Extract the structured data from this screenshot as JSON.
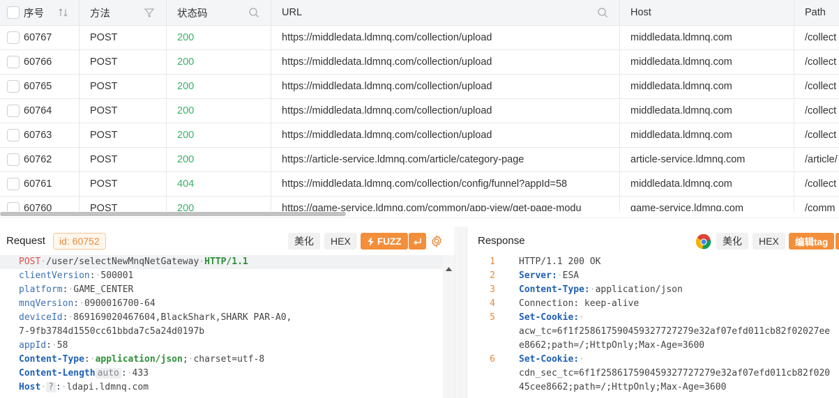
{
  "table": {
    "headers": {
      "seq": "序号",
      "method": "方法",
      "status": "状态码",
      "url": "URL",
      "host": "Host",
      "path": "Path"
    },
    "rows": [
      {
        "seq": "60767",
        "method": "POST",
        "status": "200",
        "url": "https://middledata.ldmnq.com/collection/upload",
        "host": "middledata.ldmnq.com",
        "path": "/collect"
      },
      {
        "seq": "60766",
        "method": "POST",
        "status": "200",
        "url": "https://middledata.ldmnq.com/collection/upload",
        "host": "middledata.ldmnq.com",
        "path": "/collect"
      },
      {
        "seq": "60765",
        "method": "POST",
        "status": "200",
        "url": "https://middledata.ldmnq.com/collection/upload",
        "host": "middledata.ldmnq.com",
        "path": "/collect"
      },
      {
        "seq": "60764",
        "method": "POST",
        "status": "200",
        "url": "https://middledata.ldmnq.com/collection/upload",
        "host": "middledata.ldmnq.com",
        "path": "/collect"
      },
      {
        "seq": "60763",
        "method": "POST",
        "status": "200",
        "url": "https://middledata.ldmnq.com/collection/upload",
        "host": "middledata.ldmnq.com",
        "path": "/collect"
      },
      {
        "seq": "60762",
        "method": "POST",
        "status": "200",
        "url": "https://article-service.ldmnq.com/article/category-page",
        "host": "article-service.ldmnq.com",
        "path": "/article/"
      },
      {
        "seq": "60761",
        "method": "POST",
        "status": "404",
        "url": "https://middledata.ldmnq.com/collection/config/funnel?appId=58",
        "host": "middledata.ldmnq.com",
        "path": "/collect"
      },
      {
        "seq": "60760",
        "method": "POST",
        "status": "200",
        "url": "https://game-service.ldmnq.com/common/app-view/get-page-modu",
        "host": "game-service.ldmnq.com",
        "path": "/comm"
      }
    ]
  },
  "request": {
    "title": "Request",
    "id_badge": "id: 60752",
    "beautify": "美化",
    "hex": "HEX",
    "fuzz": "FUZZ",
    "lines": {
      "method": "POST",
      "path": "/user/selectNewMnqNetGateway",
      "proto": "HTTP/1.1",
      "k1": "clientVersion",
      "v1": "500001",
      "k2": "platform",
      "v2": "GAME_CENTER",
      "k3": "mnqVersion",
      "v3": "0900016700-64",
      "k4": "deviceId",
      "v4a": "869169020467604,BlackShark,SHARK PAR-A0,",
      "v4b": "7-9fb3784d1550cc61bbda7c5a24d0197b",
      "k5": "appId",
      "v5": "58",
      "k6": "Content-Type",
      "v6a": "application/json",
      "v6b": "charset=utf-8",
      "k7": "Content-Length",
      "v7chip": "auto",
      "v7": "433",
      "k8": "Host",
      "v8chip": "?",
      "v8": "ldapi.ldmnq.com"
    }
  },
  "response": {
    "title": "Response",
    "beautify": "美化",
    "hex": "HEX",
    "edit_tag": "编辑tag",
    "lines": {
      "n1": "1",
      "l1": "HTTP/1.1 200 OK",
      "n2": "2",
      "k2": "Server:",
      "v2": "ESA",
      "n3": "3",
      "k3": "Content-Type:",
      "v3": "application/json",
      "n4": "4",
      "l4": "Connection: keep-alive",
      "n5": "5",
      "k5": "Set-Cookie:",
      "v5a": "acw_tc=6f1f258617590459327727279e32af07efd011cb82f02027ee",
      "v5b": "e8662;path=/;HttpOnly;Max-Age=3600",
      "n6": "6",
      "k6": "Set-Cookie:",
      "v6a": "cdn_sec_tc=6f1f258617590459327727279e32af07efd011cb82f020",
      "v6b": "45cee8662;path=/;HttpOnly;Max-Age=3600"
    }
  },
  "colors": {
    "accent": "#f38f3a",
    "status_ok": "#3bb06a",
    "key_blue": "#1f60b7",
    "method_red": "#d9534f"
  }
}
